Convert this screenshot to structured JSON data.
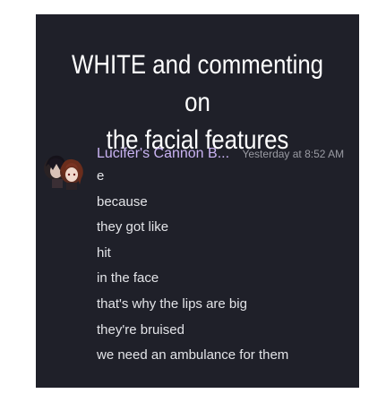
{
  "caption": {
    "line1": "WHITE and commenting on",
    "line2": "the facial features"
  },
  "message": {
    "username": "Lucifer's Cannon B...",
    "timestamp": "Yesterday at 8:52 AM",
    "avatar_icon": "two-anime-characters-avatar",
    "lines": [
      "e",
      "because",
      "they got like",
      "hit",
      "in the face",
      "that's why the lips are big",
      "they're bruised",
      "we need an ambulance for them"
    ]
  },
  "colors": {
    "background": "#1f2029",
    "caption_text": "#ffffff",
    "username": "#c9b3f2",
    "timestamp": "#9a9ba3",
    "message_text": "#e3e4e8"
  }
}
